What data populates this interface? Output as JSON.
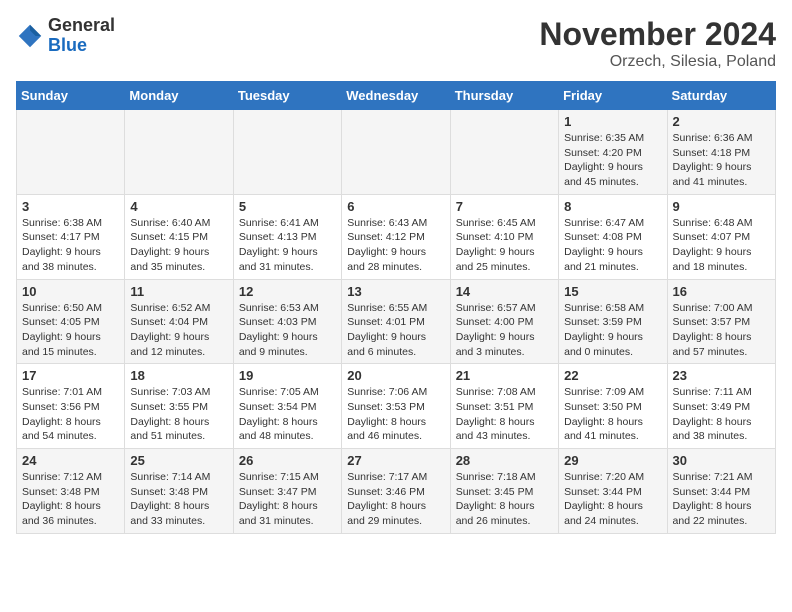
{
  "logo": {
    "general": "General",
    "blue": "Blue"
  },
  "title": "November 2024",
  "location": "Orzech, Silesia, Poland",
  "days_of_week": [
    "Sunday",
    "Monday",
    "Tuesday",
    "Wednesday",
    "Thursday",
    "Friday",
    "Saturday"
  ],
  "weeks": [
    [
      {
        "day": "",
        "info": ""
      },
      {
        "day": "",
        "info": ""
      },
      {
        "day": "",
        "info": ""
      },
      {
        "day": "",
        "info": ""
      },
      {
        "day": "",
        "info": ""
      },
      {
        "day": "1",
        "info": "Sunrise: 6:35 AM\nSunset: 4:20 PM\nDaylight: 9 hours and 45 minutes."
      },
      {
        "day": "2",
        "info": "Sunrise: 6:36 AM\nSunset: 4:18 PM\nDaylight: 9 hours and 41 minutes."
      }
    ],
    [
      {
        "day": "3",
        "info": "Sunrise: 6:38 AM\nSunset: 4:17 PM\nDaylight: 9 hours and 38 minutes."
      },
      {
        "day": "4",
        "info": "Sunrise: 6:40 AM\nSunset: 4:15 PM\nDaylight: 9 hours and 35 minutes."
      },
      {
        "day": "5",
        "info": "Sunrise: 6:41 AM\nSunset: 4:13 PM\nDaylight: 9 hours and 31 minutes."
      },
      {
        "day": "6",
        "info": "Sunrise: 6:43 AM\nSunset: 4:12 PM\nDaylight: 9 hours and 28 minutes."
      },
      {
        "day": "7",
        "info": "Sunrise: 6:45 AM\nSunset: 4:10 PM\nDaylight: 9 hours and 25 minutes."
      },
      {
        "day": "8",
        "info": "Sunrise: 6:47 AM\nSunset: 4:08 PM\nDaylight: 9 hours and 21 minutes."
      },
      {
        "day": "9",
        "info": "Sunrise: 6:48 AM\nSunset: 4:07 PM\nDaylight: 9 hours and 18 minutes."
      }
    ],
    [
      {
        "day": "10",
        "info": "Sunrise: 6:50 AM\nSunset: 4:05 PM\nDaylight: 9 hours and 15 minutes."
      },
      {
        "day": "11",
        "info": "Sunrise: 6:52 AM\nSunset: 4:04 PM\nDaylight: 9 hours and 12 minutes."
      },
      {
        "day": "12",
        "info": "Sunrise: 6:53 AM\nSunset: 4:03 PM\nDaylight: 9 hours and 9 minutes."
      },
      {
        "day": "13",
        "info": "Sunrise: 6:55 AM\nSunset: 4:01 PM\nDaylight: 9 hours and 6 minutes."
      },
      {
        "day": "14",
        "info": "Sunrise: 6:57 AM\nSunset: 4:00 PM\nDaylight: 9 hours and 3 minutes."
      },
      {
        "day": "15",
        "info": "Sunrise: 6:58 AM\nSunset: 3:59 PM\nDaylight: 9 hours and 0 minutes."
      },
      {
        "day": "16",
        "info": "Sunrise: 7:00 AM\nSunset: 3:57 PM\nDaylight: 8 hours and 57 minutes."
      }
    ],
    [
      {
        "day": "17",
        "info": "Sunrise: 7:01 AM\nSunset: 3:56 PM\nDaylight: 8 hours and 54 minutes."
      },
      {
        "day": "18",
        "info": "Sunrise: 7:03 AM\nSunset: 3:55 PM\nDaylight: 8 hours and 51 minutes."
      },
      {
        "day": "19",
        "info": "Sunrise: 7:05 AM\nSunset: 3:54 PM\nDaylight: 8 hours and 48 minutes."
      },
      {
        "day": "20",
        "info": "Sunrise: 7:06 AM\nSunset: 3:53 PM\nDaylight: 8 hours and 46 minutes."
      },
      {
        "day": "21",
        "info": "Sunrise: 7:08 AM\nSunset: 3:51 PM\nDaylight: 8 hours and 43 minutes."
      },
      {
        "day": "22",
        "info": "Sunrise: 7:09 AM\nSunset: 3:50 PM\nDaylight: 8 hours and 41 minutes."
      },
      {
        "day": "23",
        "info": "Sunrise: 7:11 AM\nSunset: 3:49 PM\nDaylight: 8 hours and 38 minutes."
      }
    ],
    [
      {
        "day": "24",
        "info": "Sunrise: 7:12 AM\nSunset: 3:48 PM\nDaylight: 8 hours and 36 minutes."
      },
      {
        "day": "25",
        "info": "Sunrise: 7:14 AM\nSunset: 3:48 PM\nDaylight: 8 hours and 33 minutes."
      },
      {
        "day": "26",
        "info": "Sunrise: 7:15 AM\nSunset: 3:47 PM\nDaylight: 8 hours and 31 minutes."
      },
      {
        "day": "27",
        "info": "Sunrise: 7:17 AM\nSunset: 3:46 PM\nDaylight: 8 hours and 29 minutes."
      },
      {
        "day": "28",
        "info": "Sunrise: 7:18 AM\nSunset: 3:45 PM\nDaylight: 8 hours and 26 minutes."
      },
      {
        "day": "29",
        "info": "Sunrise: 7:20 AM\nSunset: 3:44 PM\nDaylight: 8 hours and 24 minutes."
      },
      {
        "day": "30",
        "info": "Sunrise: 7:21 AM\nSunset: 3:44 PM\nDaylight: 8 hours and 22 minutes."
      }
    ]
  ]
}
